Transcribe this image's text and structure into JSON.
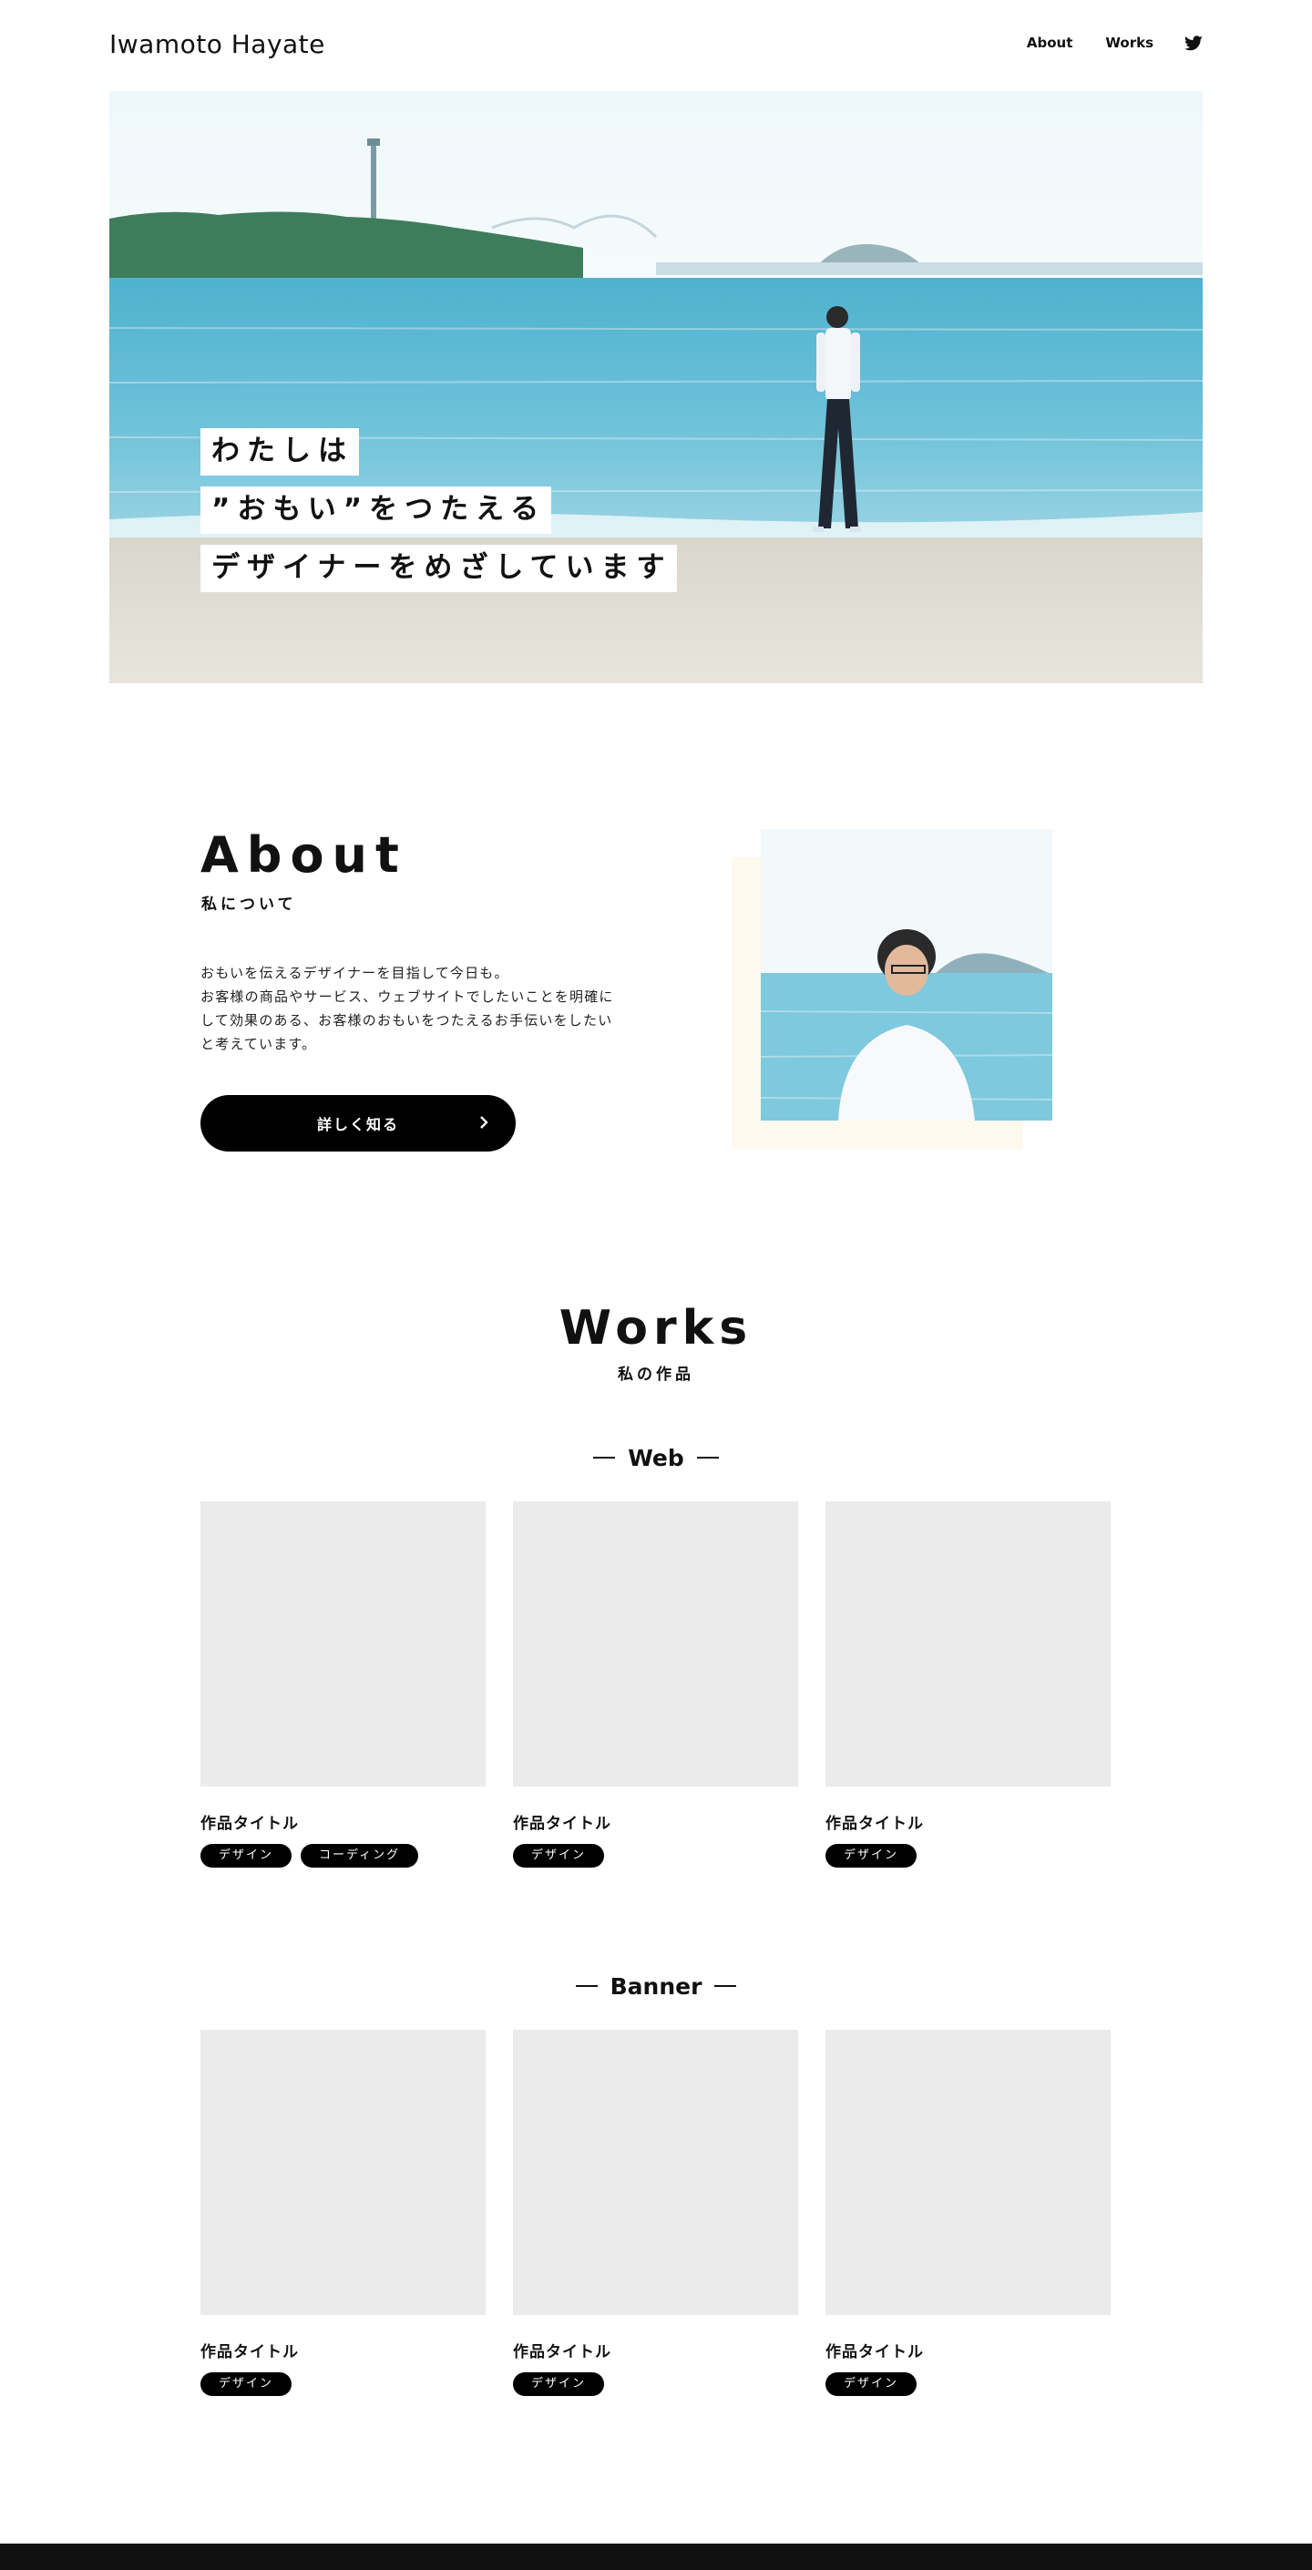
{
  "header": {
    "site_title": "Iwamoto Hayate",
    "nav": [
      {
        "label": "About"
      },
      {
        "label": "Works"
      }
    ],
    "twitter_icon": "twitter-icon"
  },
  "hero": {
    "lines": [
      "わたしは",
      "”おもい”をつたえる",
      "デザイナーをめざしています"
    ]
  },
  "about": {
    "title": "About",
    "subtitle": "私について",
    "text": [
      "おもいを伝えるデザイナーを目指して今日も。",
      "お客様の商品やサービス、ウェブサイトでしたいことを明確に",
      "して効果のある、お客様のおもいをつたえるお手伝いをしたい",
      "と考えています。"
    ],
    "button_label": "詳しく知る",
    "button_icon": "chevron-right-icon"
  },
  "works": {
    "title": "Works",
    "subtitle": "私の作品",
    "categories": [
      {
        "name": "Web",
        "items": [
          {
            "title": "作品タイトル",
            "tags": [
              "デザイン",
              "コーディング"
            ]
          },
          {
            "title": "作品タイトル",
            "tags": [
              "デザイン"
            ]
          },
          {
            "title": "作品タイトル",
            "tags": [
              "デザイン"
            ]
          }
        ]
      },
      {
        "name": "Banner",
        "items": [
          {
            "title": "作品タイトル",
            "tags": [
              "デザイン"
            ]
          },
          {
            "title": "作品タイトル",
            "tags": [
              "デザイン"
            ]
          },
          {
            "title": "作品タイトル",
            "tags": [
              "デザイン"
            ]
          }
        ]
      }
    ]
  },
  "colors": {
    "text": "#111111",
    "button_bg": "#000000",
    "thumb_placeholder": "#ebebeb",
    "about_accent": "#fdf9ec",
    "footer": "#111111"
  }
}
